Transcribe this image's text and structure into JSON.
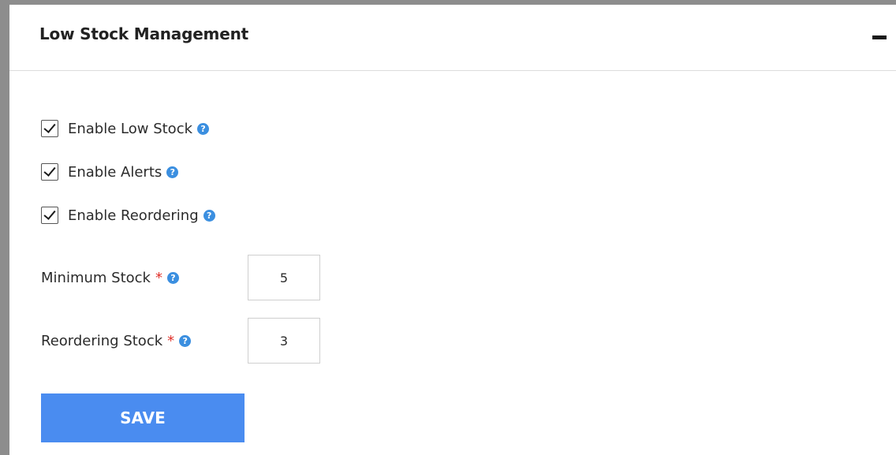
{
  "panel": {
    "title": "Low Stock Management",
    "collapse_icon": "minus-icon"
  },
  "options": [
    {
      "label": "Enable Low Stock",
      "checked": true
    },
    {
      "label": "Enable Alerts",
      "checked": true
    },
    {
      "label": "Enable Reordering",
      "checked": true
    }
  ],
  "fields": {
    "minimum_stock": {
      "label": "Minimum Stock",
      "required_mark": "*",
      "value": "5"
    },
    "reordering_stock": {
      "label": "Reordering Stock",
      "required_mark": "*",
      "value": "3"
    }
  },
  "help_icon": {
    "glyph": "?",
    "name": "help-icon",
    "color": "#3b8fe0"
  },
  "save_button": {
    "label": "SAVE",
    "color": "#4a8cf0"
  }
}
